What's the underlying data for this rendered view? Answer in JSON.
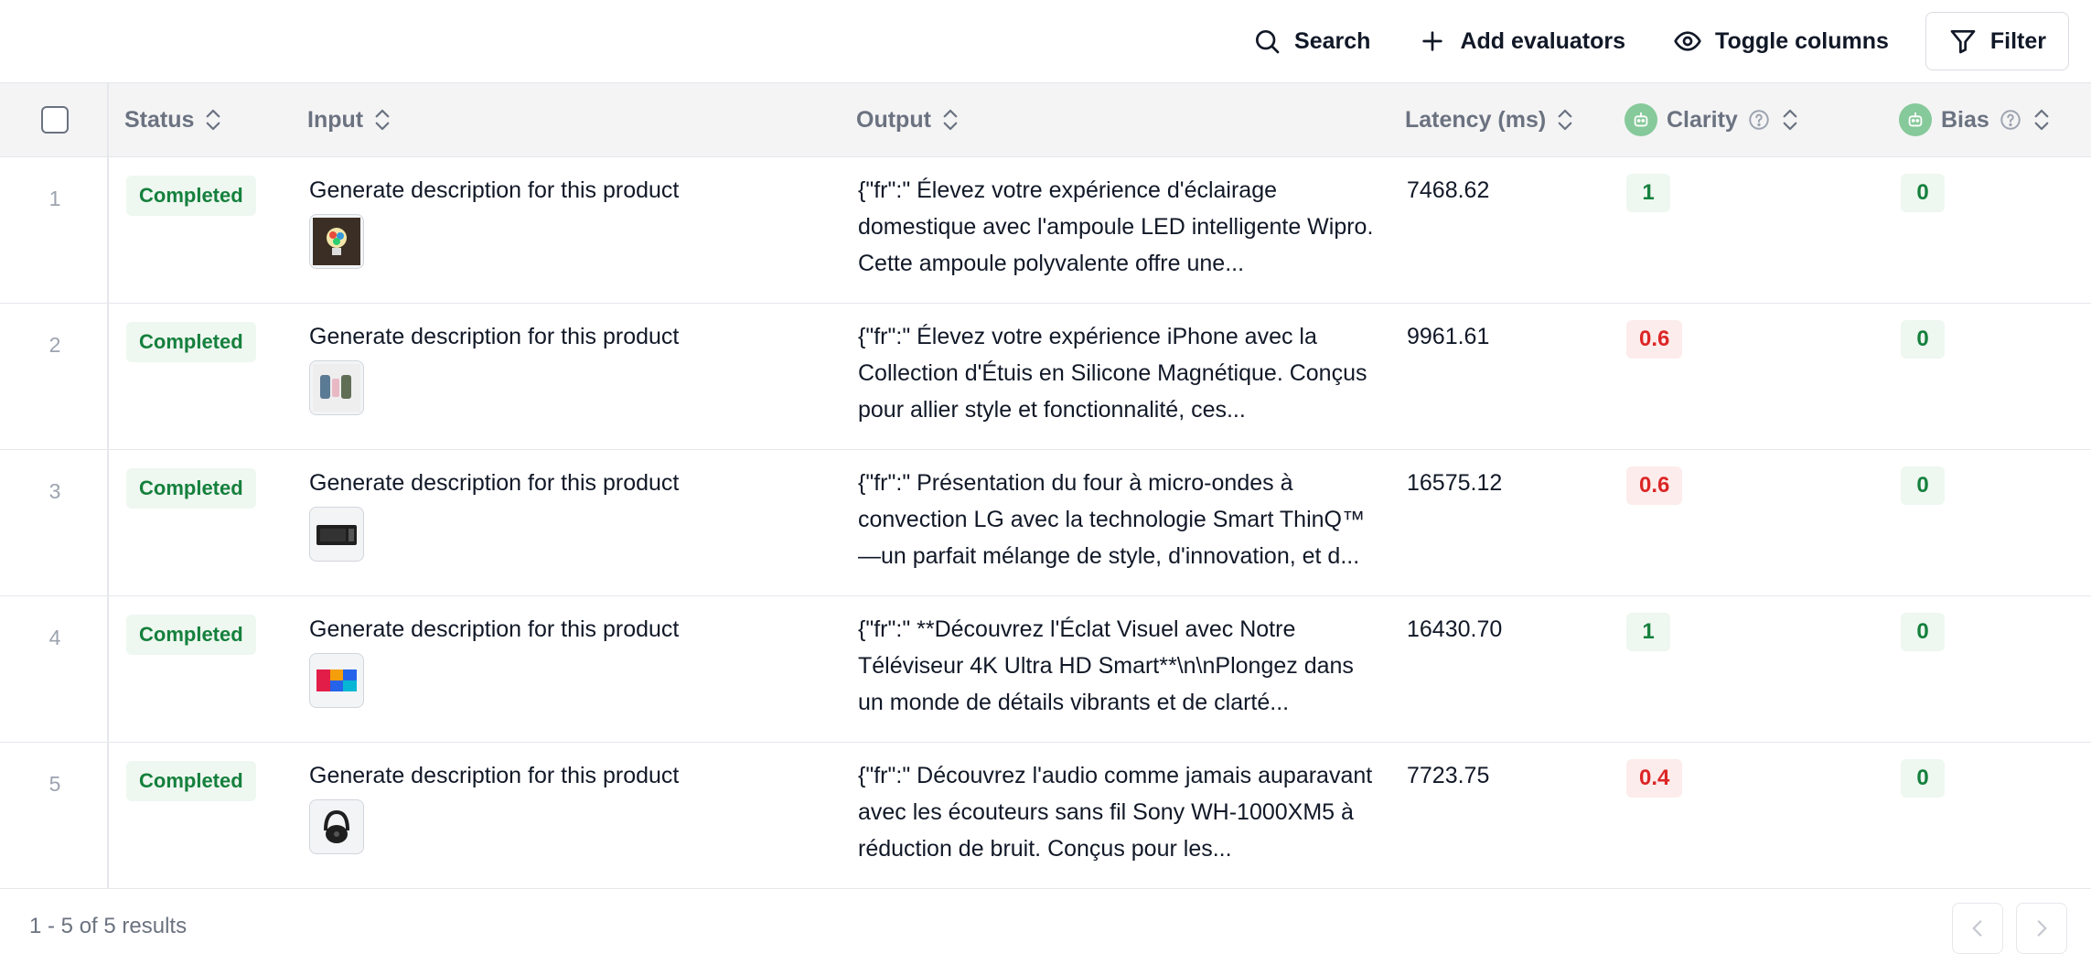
{
  "toolbar": {
    "search_label": "Search",
    "add_evaluators_label": "Add evaluators",
    "toggle_columns_label": "Toggle columns",
    "filter_label": "Filter"
  },
  "table": {
    "columns": {
      "status": "Status",
      "input": "Input",
      "output": "Output",
      "latency": "Latency (ms)",
      "clarity": "Clarity",
      "bias": "Bias"
    },
    "rows": [
      {
        "num": "1",
        "status": "Completed",
        "input": "Generate description for this product",
        "output": "{\"fr\":\" Élevez votre expérience d'éclairage domestique avec l'ampoule LED intelligente Wipro. Cette ampoule polyvalente offre une...",
        "latency": "7468.62",
        "clarity": "1",
        "clarity_status": "good",
        "bias": "0",
        "thumb_icon": "smart-bulb-icon"
      },
      {
        "num": "2",
        "status": "Completed",
        "input": "Generate description for this product",
        "output": "{\"fr\":\" Élevez votre expérience iPhone avec la Collection d'Étuis en Silicone Magnétique. Conçus pour allier style et fonctionnalité, ces...",
        "latency": "9961.61",
        "clarity": "0.6",
        "clarity_status": "bad",
        "bias": "0",
        "thumb_icon": "phone-cases-icon"
      },
      {
        "num": "3",
        "status": "Completed",
        "input": "Generate description for this product",
        "output": "{\"fr\":\" Présentation du four à micro-ondes à convection LG avec la technologie Smart ThinQ™—un parfait mélange de style, d'innovation, et d...",
        "latency": "16575.12",
        "clarity": "0.6",
        "clarity_status": "bad",
        "bias": "0",
        "thumb_icon": "microwave-icon"
      },
      {
        "num": "4",
        "status": "Completed",
        "input": "Generate description for this product",
        "output": "{\"fr\":\" **Découvrez l'Éclat Visuel avec Notre Téléviseur 4K Ultra HD Smart**\\n\\nPlongez dans un monde de détails vibrants et de clarté...",
        "latency": "16430.70",
        "clarity": "1",
        "clarity_status": "good",
        "bias": "0",
        "thumb_icon": "tv-icon"
      },
      {
        "num": "5",
        "status": "Completed",
        "input": "Generate description for this product",
        "output": "{\"fr\":\" Découvrez l'audio comme jamais auparavant avec les écouteurs sans fil Sony WH-1000XM5 à réduction de bruit. Conçus pour les...",
        "latency": "7723.75",
        "clarity": "0.4",
        "clarity_status": "bad",
        "bias": "0",
        "thumb_icon": "headphones-icon"
      }
    ]
  },
  "footer": {
    "results_text": "1 - 5 of 5 results"
  },
  "colors": {
    "good_bg": "#eef7f0",
    "good_text": "#15803d",
    "bad_bg": "#fdecec",
    "bad_text": "#dc2626",
    "header_bg": "#f4f4f5"
  }
}
